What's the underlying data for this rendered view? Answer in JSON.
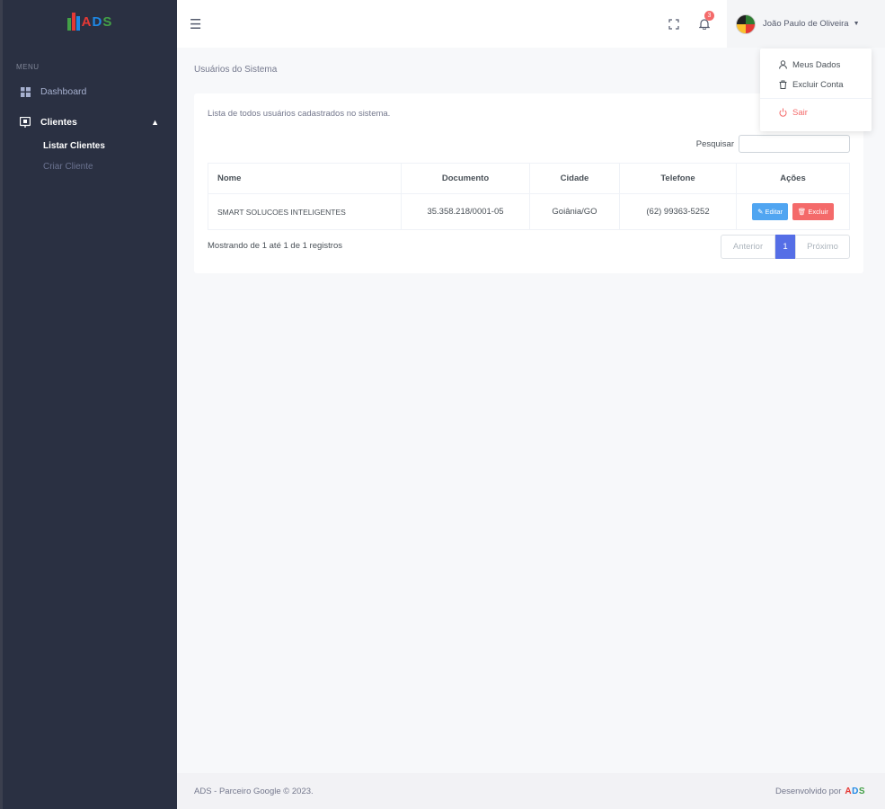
{
  "brand": {
    "logo_text": "ADS",
    "colors": {
      "primary": "#556ee6",
      "sidebar": "#2a3042",
      "red": "#f46a6a",
      "blue": "#50a5f1",
      "logo_red": "#e53935",
      "logo_blue": "#1e88e5",
      "logo_green": "#43a047"
    }
  },
  "sidebar": {
    "menu_title": "MENU",
    "items": [
      {
        "label": "Dashboard",
        "icon": "dashboard-icon"
      },
      {
        "label": "Clientes",
        "icon": "clients-icon",
        "expanded": true,
        "children": [
          {
            "label": "Listar Clientes",
            "active": true
          },
          {
            "label": "Criar Cliente",
            "active": false
          }
        ]
      }
    ]
  },
  "topbar": {
    "menu_icon": "hamburger-icon",
    "notification_count": "3",
    "user_name": "João Paulo de Oliveira"
  },
  "user_menu": {
    "items": [
      {
        "label": "Meus Dados",
        "icon": "user-icon"
      },
      {
        "label": "Excluir Conta",
        "icon": "trash-icon"
      },
      {
        "label": "Sair",
        "icon": "power-icon"
      }
    ]
  },
  "page": {
    "title": "Usuários do Sistema",
    "description": "Lista de todos usuários cadastrados no sistema.",
    "search_label": "Pesquisar",
    "search_value": "",
    "table": {
      "headers": [
        "Nome",
        "Documento",
        "Cidade",
        "Telefone",
        "Ações"
      ],
      "rows": [
        [
          "SMART SOLUCOES INTELIGENTES",
          "35.358.218/0001-05",
          "Goiânia/GO",
          "(62) 99363-5252"
        ]
      ],
      "edit_label": "Editar",
      "delete_label": "Excluir"
    },
    "info": "Mostrando de 1 até 1 de 1 registros",
    "pagination": {
      "prev": "Anterior",
      "current": "1",
      "next": "Próximo"
    }
  },
  "footer": {
    "left": "ADS - Parceiro Google © 2023.",
    "right": "Desenvolvido por",
    "logo": "ADS"
  }
}
